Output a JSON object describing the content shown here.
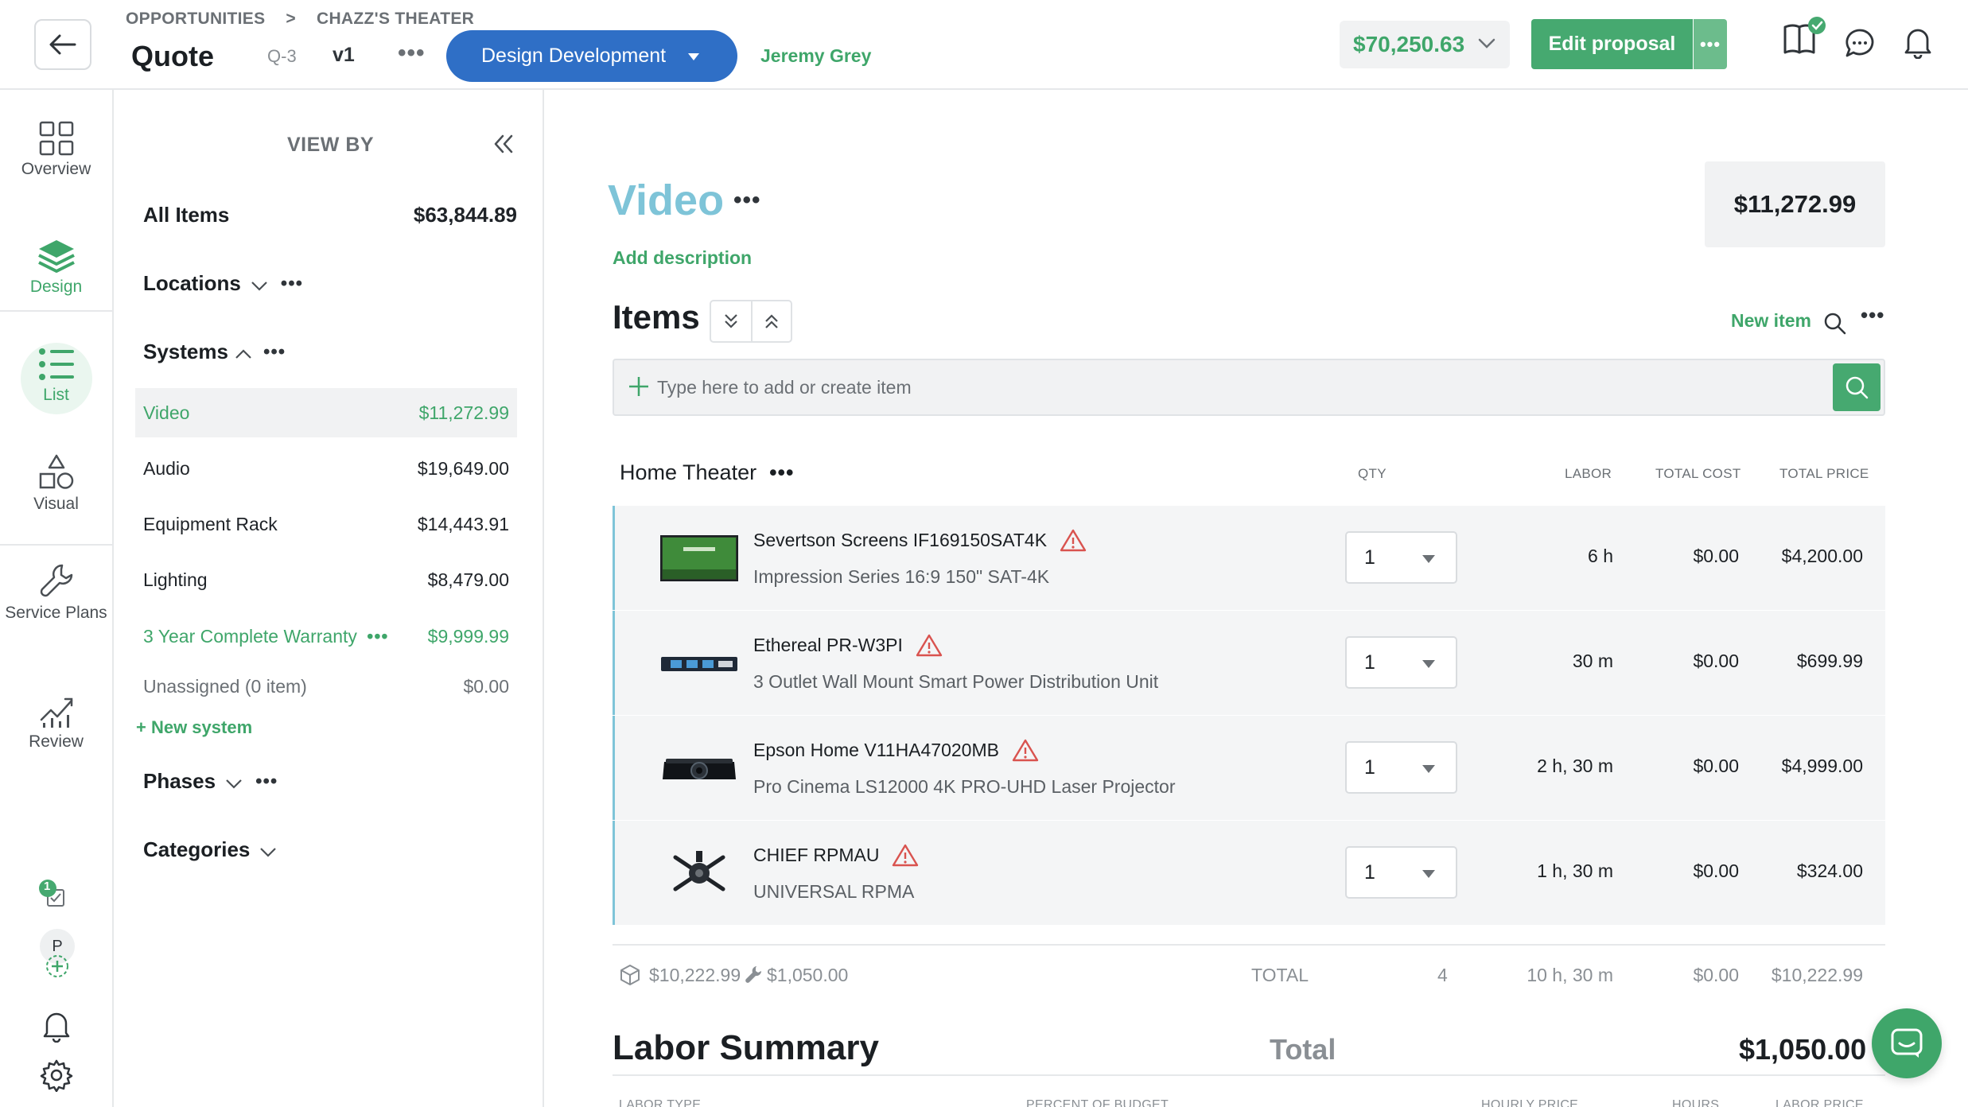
{
  "header": {
    "breadcrumb": [
      "OPPORTUNITIES",
      ">",
      "CHAZZ'S THEATER"
    ],
    "title": "Quote",
    "quote_id": "Q-3",
    "version": "v1",
    "more": "•••",
    "status": "Design Development",
    "owner": "Jeremy Grey",
    "total": "$70,250.63",
    "edit_label": "Edit proposal",
    "edit_more": "•••",
    "icons": [
      "back-arrow-icon",
      "book-check-icon",
      "chat-bubble-icon",
      "bell-icon"
    ]
  },
  "rail": {
    "items": [
      {
        "label": "Overview",
        "icon": "grid-icon"
      },
      {
        "label": "Design",
        "icon": "layers-icon",
        "active": true
      },
      {
        "label": "List",
        "icon": "list-icon",
        "active": true
      },
      {
        "label": "Visual",
        "icon": "shapes-icon"
      },
      {
        "label": "Service Plans",
        "icon": "wrench-icon"
      },
      {
        "label": "Review",
        "icon": "chart-icon"
      }
    ],
    "badge_count": "1",
    "avatar_initial": "P"
  },
  "panel": {
    "view_by": "VIEW BY",
    "all_items_label": "All Items",
    "all_items_value": "$63,844.89",
    "locations": "Locations",
    "systems": "Systems",
    "phases": "Phases",
    "categories": "Categories",
    "more": "•••",
    "system_rows": [
      {
        "label": "Video",
        "value": "$11,272.99"
      },
      {
        "label": "Audio",
        "value": "$19,649.00"
      },
      {
        "label": "Equipment Rack",
        "value": "$14,443.91"
      },
      {
        "label": "Lighting",
        "value": "$8,479.00"
      },
      {
        "label": "3 Year Complete Warranty",
        "value": "$9,999.99",
        "more": "•••"
      },
      {
        "label": "Unassigned (0 item)",
        "value": "$0.00"
      }
    ],
    "new_system": "+ New system"
  },
  "main": {
    "section_title": "Video",
    "section_more": "•••",
    "add_description": "Add description",
    "section_price": "$11,272.99",
    "items_title": "Items",
    "new_item": "New item",
    "items_more": "•••",
    "add_placeholder": "Type here to add or create item",
    "group_title": "Home Theater",
    "group_more": "•••",
    "columns": {
      "qty": "QTY",
      "labor": "LABOR",
      "total_cost": "TOTAL COST",
      "total_price": "TOTAL PRICE"
    },
    "items": [
      {
        "name": "Severtson Screens IF169150SAT4K",
        "desc": "Impression Series 16:9 150\" SAT-4K",
        "qty": "1",
        "labor": "6 h",
        "cost": "$0.00",
        "price": "$4,200.00",
        "thumb": "screen-thumb"
      },
      {
        "name": "Ethereal PR-W3PI",
        "desc": "3 Outlet Wall Mount Smart Power Distribution Unit",
        "qty": "1",
        "labor": "30 m",
        "cost": "$0.00",
        "price": "$699.99",
        "thumb": "power-strip-thumb"
      },
      {
        "name": "Epson Home V11HA47020MB",
        "desc": "Pro Cinema LS12000 4K PRO-UHD Laser Projector",
        "qty": "1",
        "labor": "2 h, 30 m",
        "cost": "$0.00",
        "price": "$4,999.00",
        "thumb": "projector-thumb"
      },
      {
        "name": "CHIEF RPMAU",
        "desc": "UNIVERSAL RPMA",
        "qty": "1",
        "labor": "1 h, 30 m",
        "cost": "$0.00",
        "price": "$324.00",
        "thumb": "mount-thumb"
      }
    ],
    "totals": {
      "equipment": "$10,222.99",
      "labor_cost": "$1,050.00",
      "label": "TOTAL",
      "qty": "4",
      "labor": "10 h, 30 m",
      "cost": "$0.00",
      "price": "$10,222.99"
    },
    "labor_summary": {
      "title": "Labor Summary",
      "total_label": "Total",
      "total": "$1,050.00",
      "columns": [
        "LABOR TYPE",
        "PERCENT OF BUDGET",
        "HOURLY PRICE",
        "HOURS",
        "LABOR PRICE"
      ]
    }
  },
  "colors": {
    "accent": "#3fa66a",
    "status_blue": "#2f6fc6",
    "title_blue": "#7ec4d8",
    "warning": "#d9534f"
  }
}
